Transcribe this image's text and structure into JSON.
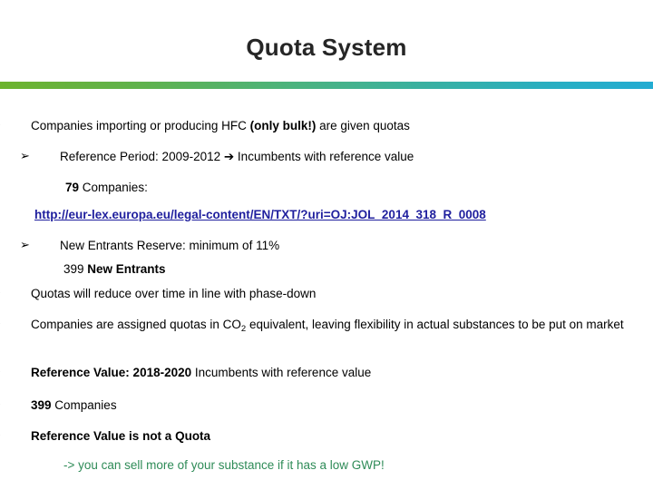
{
  "slide": {
    "title": "Quota System",
    "accent_start": "#6db32e",
    "accent_end": "#23acd2",
    "bullet_glyph": "➢"
  },
  "content": {
    "b1_a": "Companies importing or producing HFC ",
    "b1_b": "(only bulk!)",
    "b1_c": " are given quotas",
    "b2": "Reference Period: 2009-2012 ➔ Incumbents with reference value",
    "b3_a": "79",
    "b3_b": " Companies:",
    "link": "http://eur-lex.europa.eu/legal-content/EN/TXT/?uri=OJ:JOL_2014_318_R_0008",
    "b4": "New Entrants Reserve: minimum of 11%",
    "b5_a": "399 ",
    "b5_b": "New Entrants",
    "b6": "Quotas will reduce over time in line with phase-down",
    "b7_a": "Companies are assigned quotas in CO",
    "b7_sub": "2",
    "b7_b": " equivalent, leaving flexibility in actual substances to be put on market",
    "b8_a": "Reference Value: 2018-2020",
    "b8_b": "  Incumbents with reference value",
    "b9_a": "399",
    "b9_b": " Companies",
    "b10": "Reference Value is not a Quota",
    "note": "-> you can sell more of your substance if it has a low GWP!"
  }
}
